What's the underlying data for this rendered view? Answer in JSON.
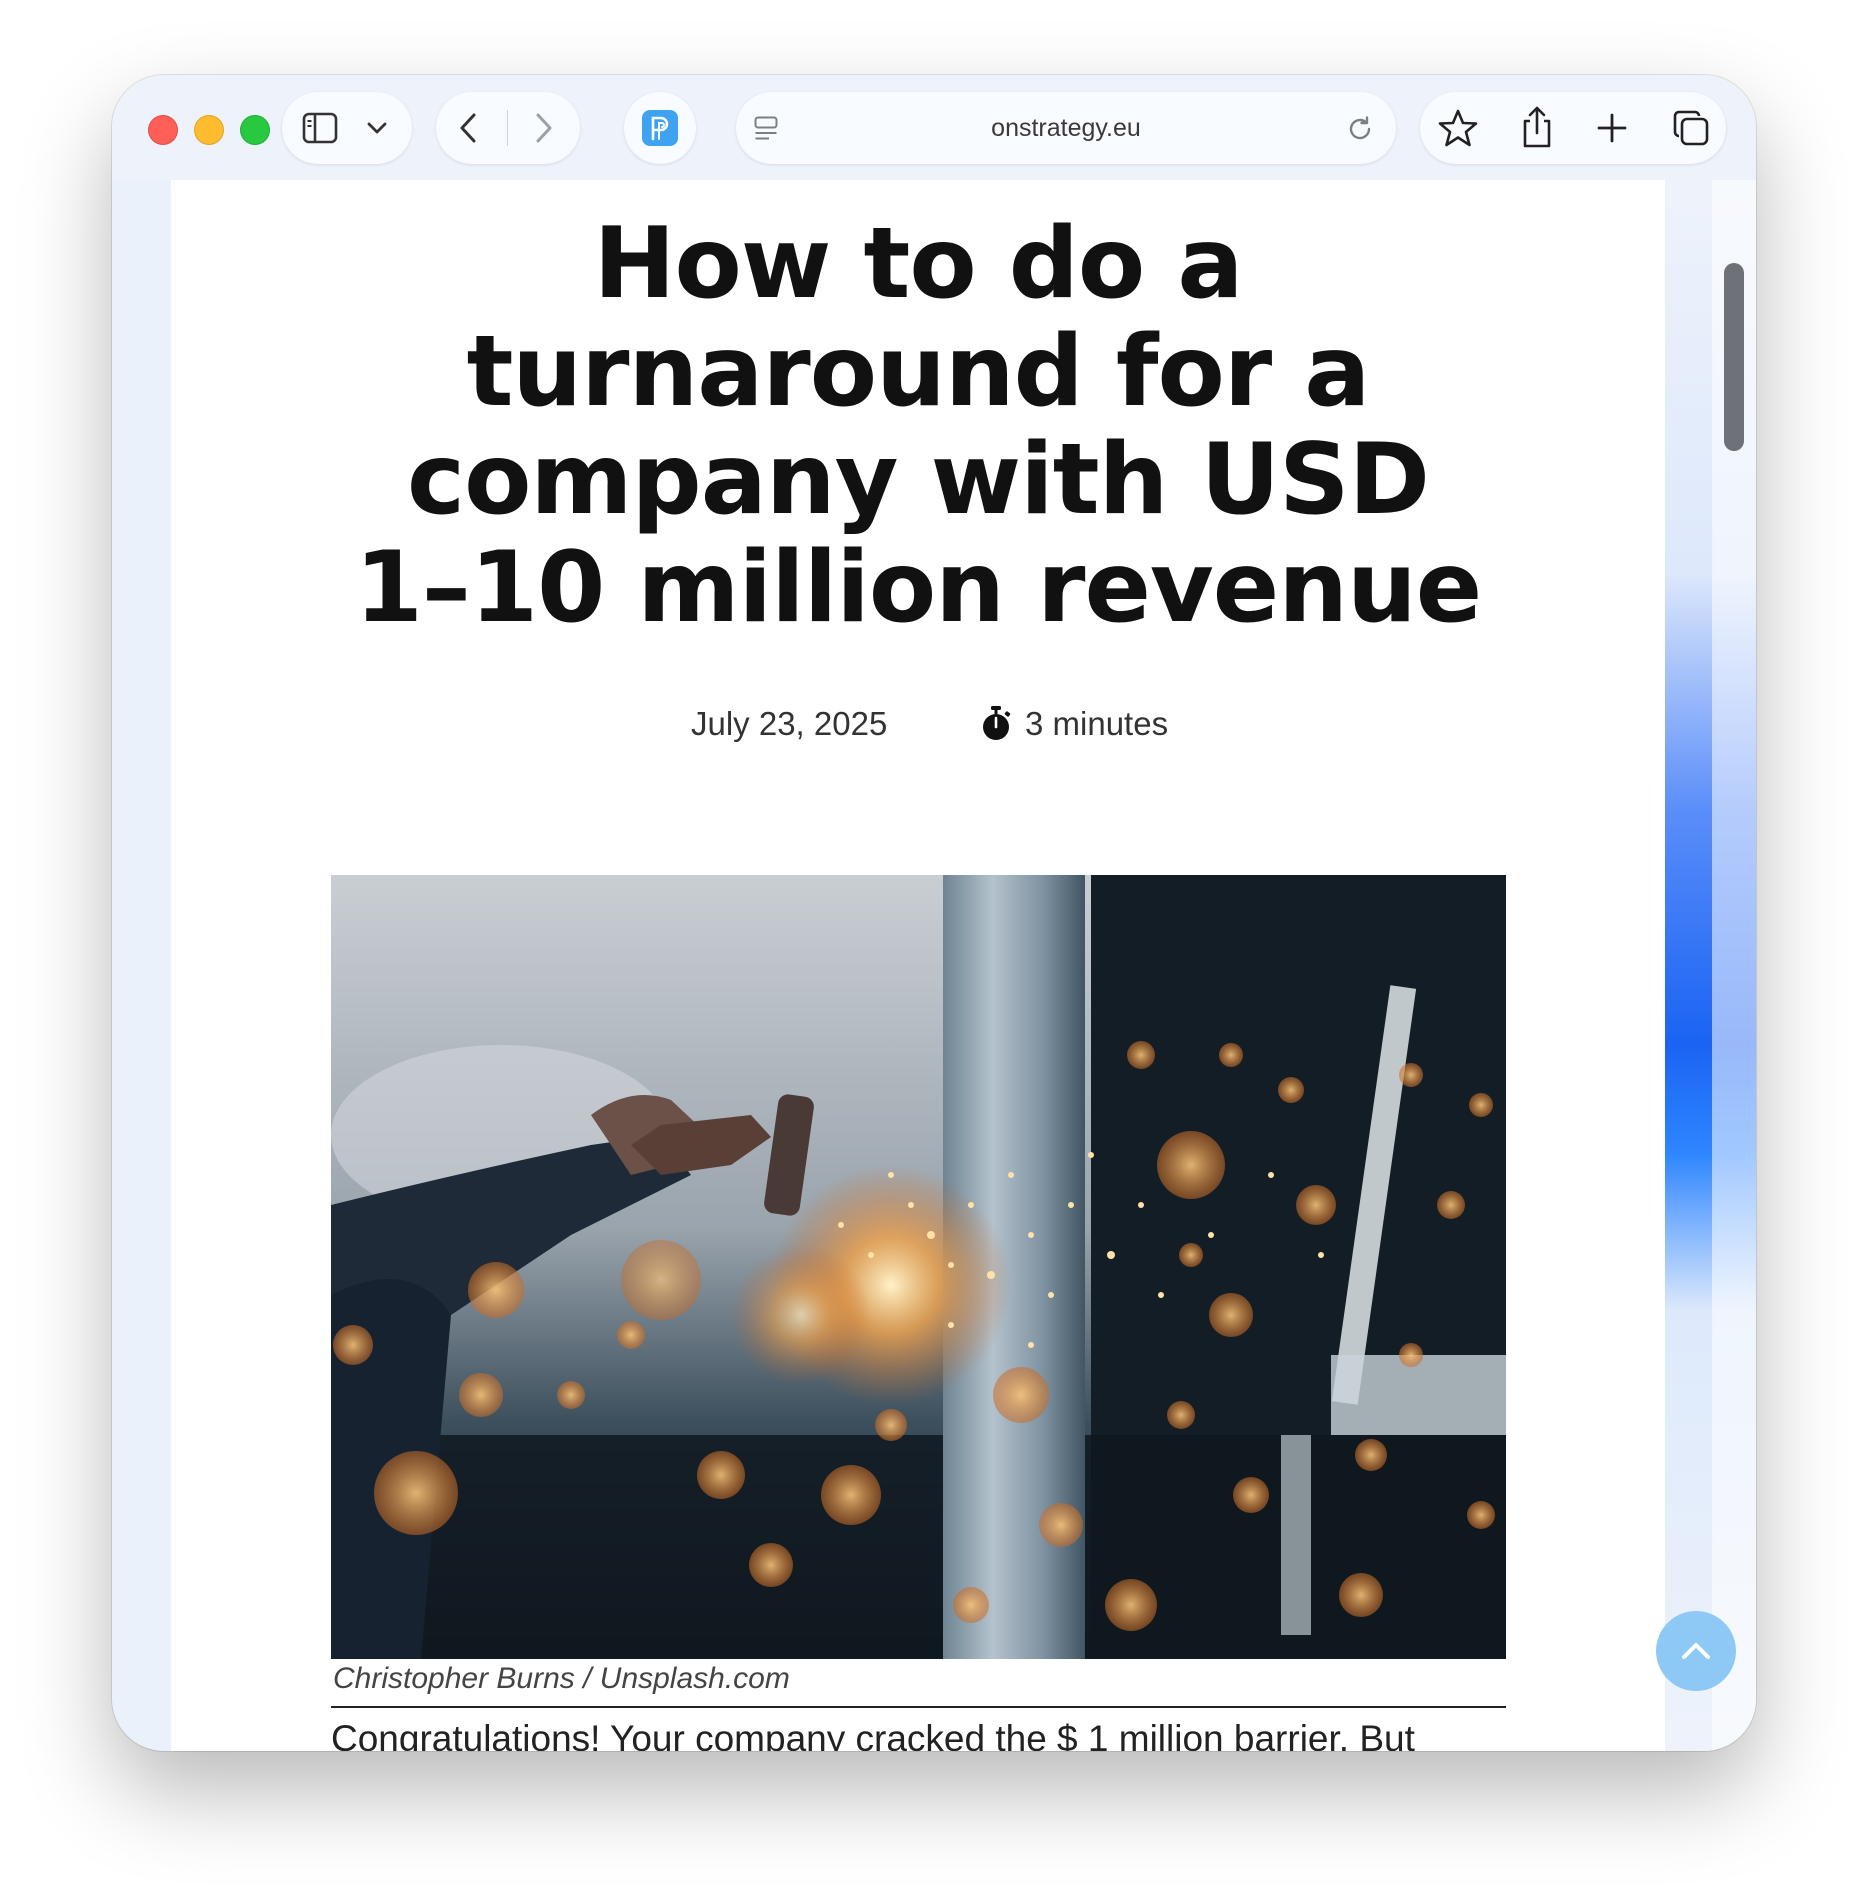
{
  "browser": {
    "url": "onstrategy.eu",
    "icons": [
      "sidebar-icon",
      "chevron-down-icon",
      "back-icon",
      "forward-icon",
      "extension-icon",
      "reader-icon",
      "reload-icon",
      "star-icon",
      "share-icon",
      "plus-icon",
      "tabs-icon"
    ]
  },
  "article": {
    "title_lines": [
      "How to do a",
      "turnaround for a",
      "company with USD",
      "1–10 million revenue"
    ],
    "date": "July 23, 2025",
    "read_time": "3 minutes",
    "image_caption": "Christopher Burns / Unsplash.com",
    "first_paragraph": "Congratulations! Your company cracked the $ 1 million barrier. But"
  },
  "colors": {
    "accent": "#2f86ff",
    "scroll_top_button": "#8ec9f6",
    "title": "#111111"
  }
}
